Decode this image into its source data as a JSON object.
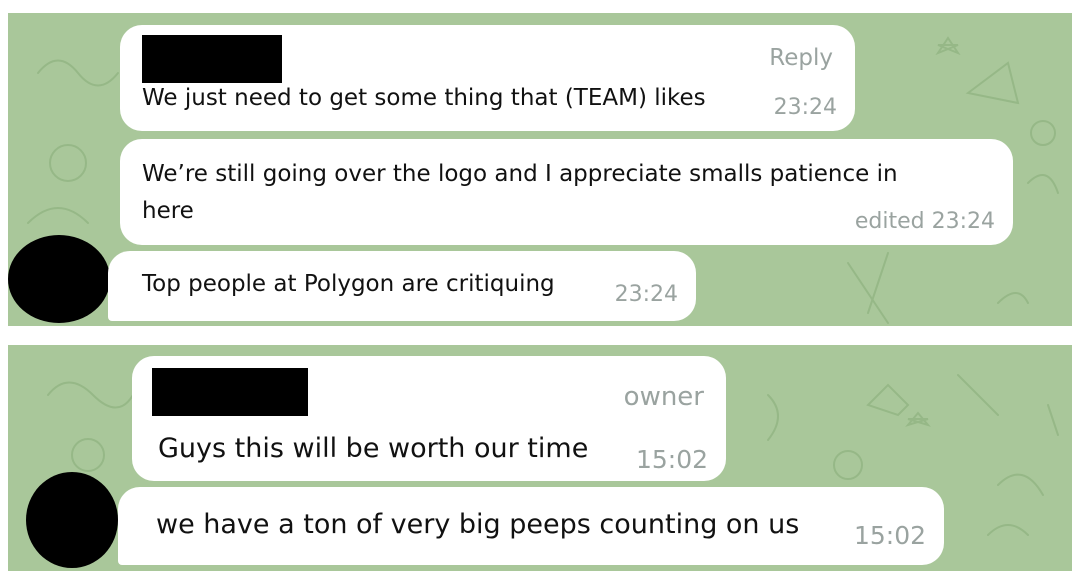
{
  "colors": {
    "chat_background": "#a9c79a",
    "doodle": "#96b887",
    "bubble": "#ffffff",
    "text": "#111111",
    "meta_text": "#9aa3a0",
    "redaction": "#000000"
  },
  "top_panel": {
    "messages": [
      {
        "sender_badge": "Reply",
        "text": "We just need to get some thing that (TEAM) likes",
        "time": "23:24"
      },
      {
        "text_line1": "We’re still going over the logo and I appreciate smalls patience in",
        "text_line2": "here",
        "time": "edited 23:24"
      },
      {
        "text": "Top people at Polygon are critiquing",
        "time": "23:24"
      }
    ]
  },
  "bottom_panel": {
    "messages": [
      {
        "sender_badge": "owner",
        "text": "Guys this will be worth our time",
        "time": "15:02"
      },
      {
        "text": "we have a ton of very big peeps counting on us",
        "time": "15:02"
      }
    ]
  }
}
